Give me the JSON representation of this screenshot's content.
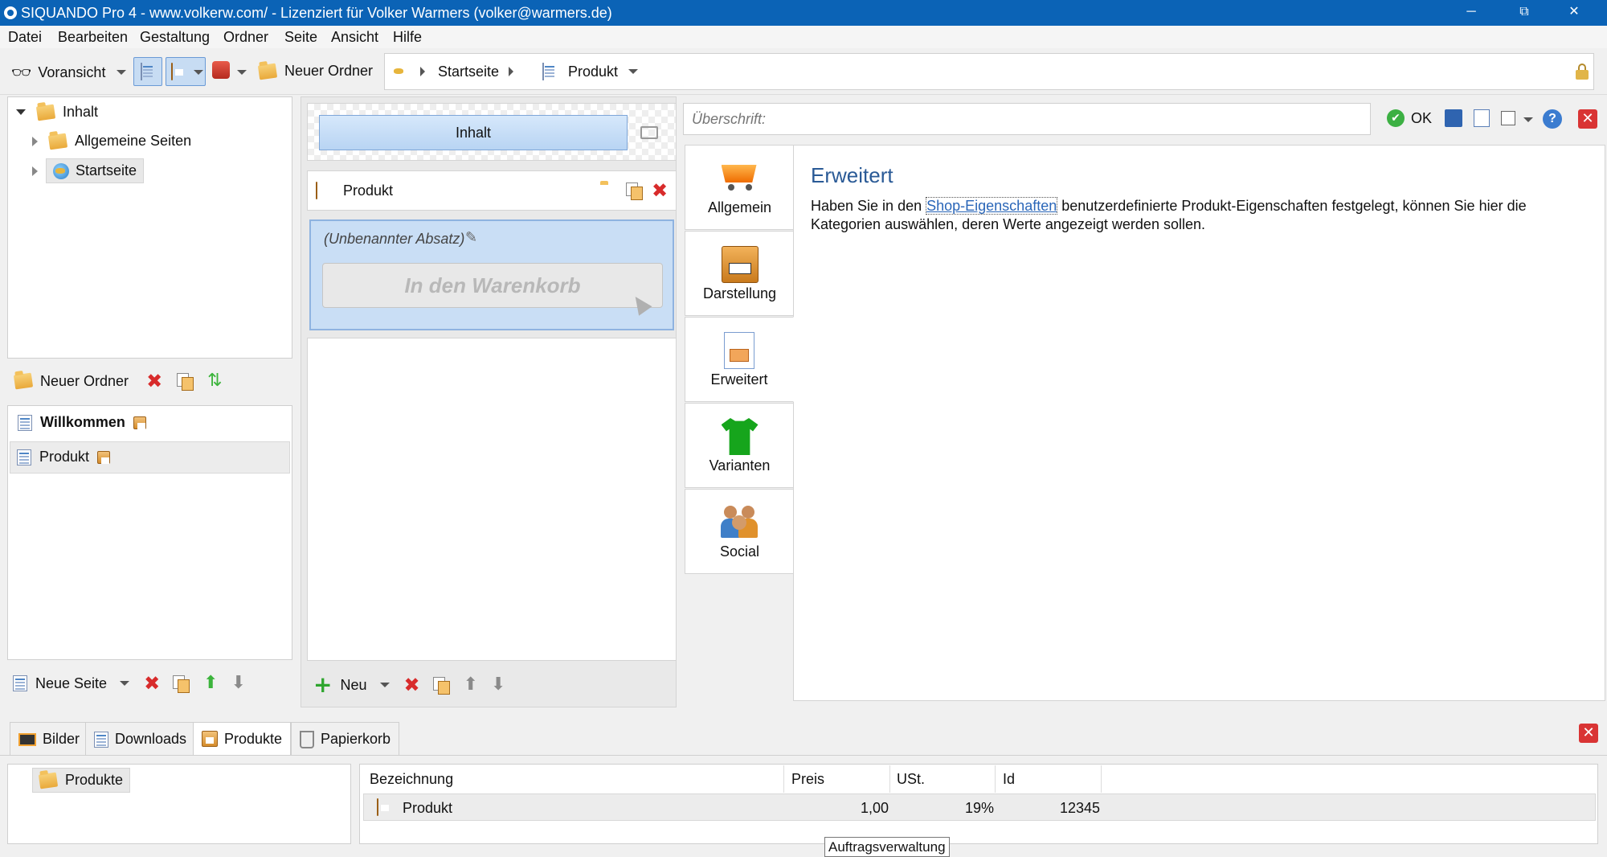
{
  "window": {
    "title": "SIQUANDO Pro 4 - www.volkerw.com/ - Lizenziert für Volker Warmers (volker@warmers.de)",
    "minimize": "─",
    "maximize": "⧉",
    "close": "✕"
  },
  "menu": [
    "Datei",
    "Bearbeiten",
    "Gestaltung",
    "Ordner",
    "Seite",
    "Ansicht",
    "Hilfe"
  ],
  "toolbar": {
    "preview_label": "Voransicht",
    "new_folder_label": "Neuer Ordner",
    "breadcrumb": [
      "Startseite",
      "Produkt"
    ]
  },
  "tree": {
    "root": "Inhalt",
    "items": [
      "Allgemeine Seiten",
      "Startseite"
    ]
  },
  "folder_actions": {
    "new_folder_label": "Neuer Ordner"
  },
  "pages": {
    "items": [
      {
        "label": "Willkommen",
        "bold": true
      },
      {
        "label": "Produkt",
        "bold": false
      }
    ]
  },
  "page_actions": {
    "new_page_label": "Neue Seite"
  },
  "content": {
    "section_button": "Inhalt",
    "header_label": "Produkt",
    "paragraph_title": "(Unbenannter Absatz)",
    "cart_button": "In den Warenkorb",
    "new_label": "Neu"
  },
  "editor": {
    "heading_placeholder": "Überschrift:",
    "ok_label": "OK",
    "tabs": [
      "Allgemein",
      "Darstellung",
      "Erweitert",
      "Varianten",
      "Social"
    ],
    "active_tab": "Erweitert",
    "panel_title": "Erweitert",
    "description_before": "Haben Sie in den ",
    "description_link": "Shop-Eigenschaften",
    "description_after": " benutzerdefinierte Produkt-Eigenschaften festgelegt, können Sie hier die Kategorien auswählen, deren Werte angezeigt werden sollen."
  },
  "bottom_tabs": [
    "Bilder",
    "Downloads",
    "Produkte",
    "Papierkorb"
  ],
  "bottom_active_tab": "Produkte",
  "products_tree": {
    "root": "Produkte"
  },
  "products_table": {
    "columns": [
      "Bezeichnung",
      "Preis",
      "USt.",
      "Id"
    ],
    "rows": [
      {
        "name": "Produkt",
        "price": "1,00",
        "vat": "19%",
        "id": "12345"
      }
    ]
  },
  "tooltip": "Auftragsverwaltung",
  "colors": {
    "titlebar": "#0b63b6",
    "accent_title": "#2a5a96",
    "selection": "#c9def5",
    "link": "#2a66b8"
  }
}
